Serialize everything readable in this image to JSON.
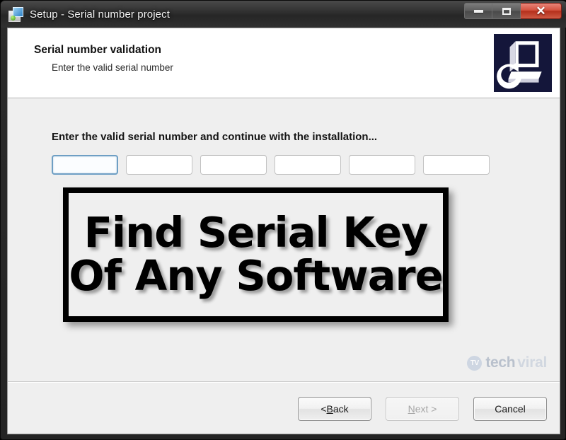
{
  "window": {
    "title": "Setup - Serial number project",
    "icon": "setup-disk-icon",
    "controls": {
      "minimize": "minimize-icon",
      "maximize": "maximize-icon",
      "close": "✕"
    }
  },
  "header": {
    "title": "Serial number validation",
    "subtitle": "Enter the valid serial number",
    "logo_icon": "installer-computer-icon",
    "logo_bg": "#14163a"
  },
  "body": {
    "instruction": "Enter the valid serial number and continue with the installation...",
    "serial_fields": [
      {
        "value": "",
        "placeholder": "",
        "focused": true
      },
      {
        "value": "",
        "placeholder": "",
        "focused": false
      },
      {
        "value": "",
        "placeholder": "",
        "focused": false
      },
      {
        "value": "",
        "placeholder": "",
        "focused": false
      },
      {
        "value": "",
        "placeholder": "",
        "focused": false
      },
      {
        "value": "",
        "placeholder": "",
        "focused": false
      }
    ],
    "overlay": {
      "line1": "Find Serial Key",
      "line2": "Of Any Software"
    }
  },
  "watermark": {
    "badge": "TV",
    "name_first": "tech",
    "name_second": "viral"
  },
  "footer": {
    "back": {
      "prefix": "< ",
      "mnemonic": "B",
      "suffix": "ack",
      "disabled": false
    },
    "next": {
      "prefix": "",
      "mnemonic": "N",
      "suffix": "ext >",
      "disabled": true
    },
    "cancel": {
      "label": "Cancel",
      "disabled": false
    }
  },
  "colors": {
    "titlebar": "#2e2e2e",
    "body_bg": "#efefef",
    "focus_border": "#6e9fc4",
    "close_button": "#b4301c"
  }
}
